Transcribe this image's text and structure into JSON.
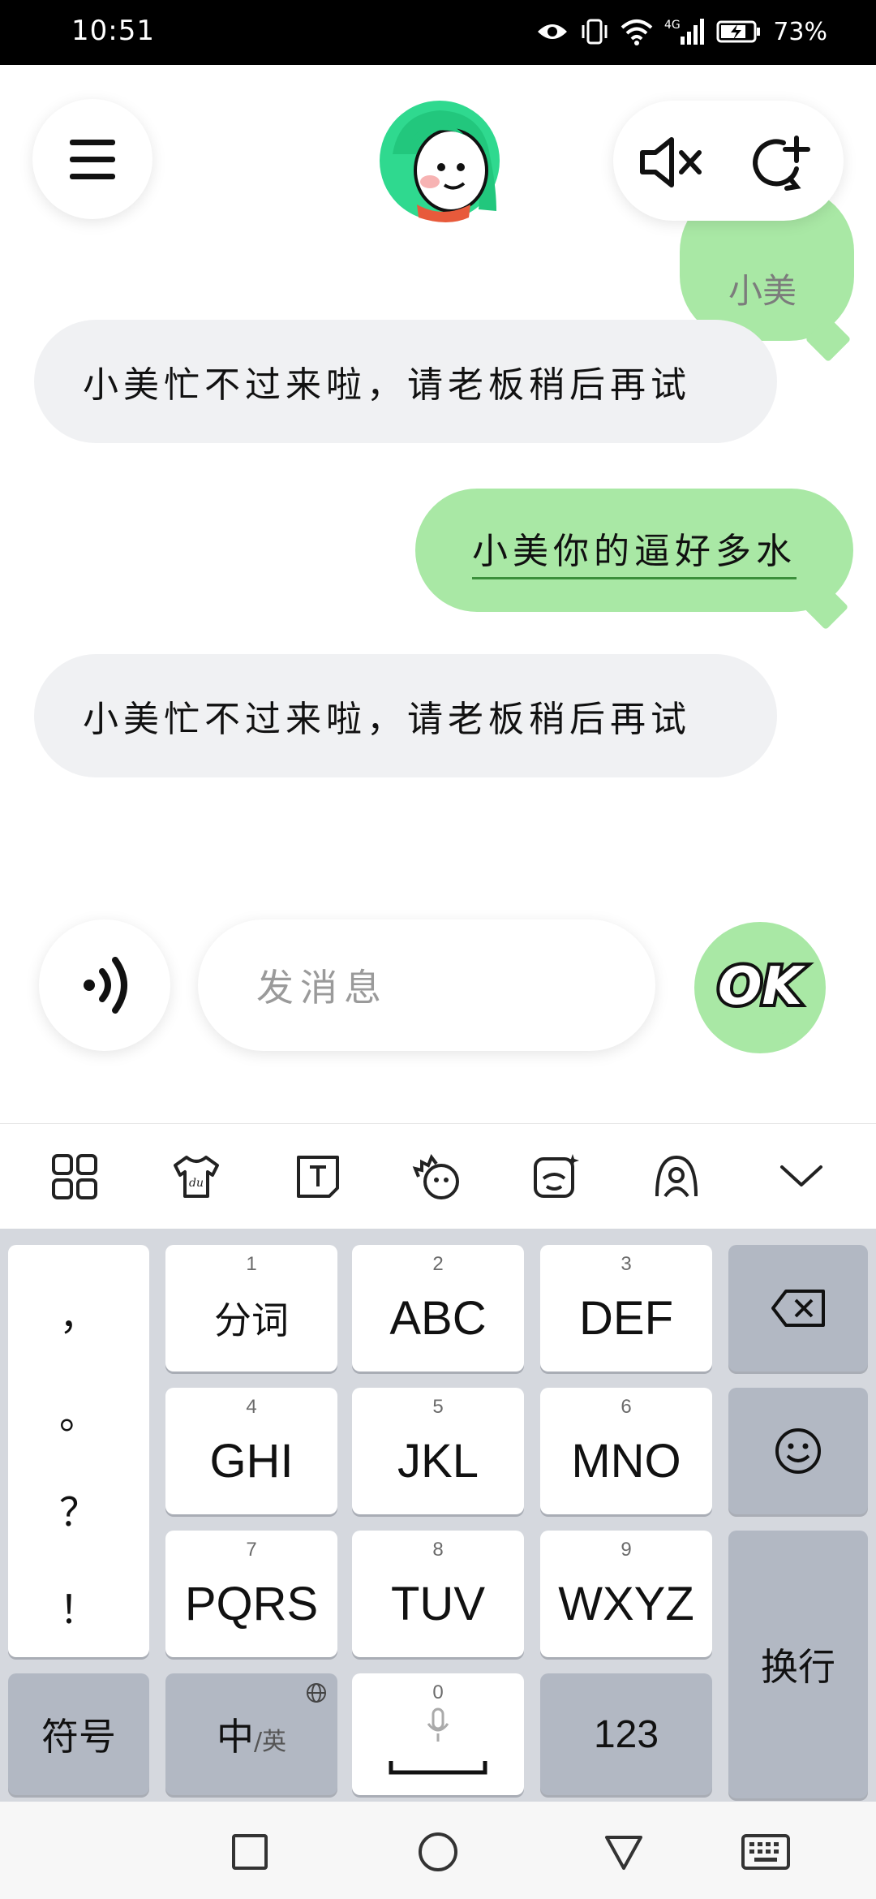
{
  "status_bar": {
    "time": "10:51",
    "battery_percent": "73%",
    "network": "4G",
    "icons": [
      "eye-icon",
      "vibrate-icon",
      "wifi-icon",
      "signal-icon",
      "battery-icon"
    ]
  },
  "header": {
    "menu_icon": "menu-icon",
    "avatar_icon": "character-avatar",
    "mute_icon": "speaker-mute-icon",
    "new_chat_icon": "refresh-plus-icon"
  },
  "messages": [
    {
      "side": "right",
      "text": "小美",
      "partial": true
    },
    {
      "side": "left",
      "text": "小美忙不过来啦，请老板稍后再试"
    },
    {
      "side": "right",
      "text": "小美你的逼好多水"
    },
    {
      "side": "left",
      "text": "小美忙不过来啦，请老板稍后再试"
    }
  ],
  "composer": {
    "placeholder": "发消息",
    "send_label": "OK",
    "voice_icon": "voice-wave-icon"
  },
  "keyboard_toolbar": {
    "icons": [
      "grid-icon",
      "skin-icon",
      "text-icon",
      "sticker-icon",
      "emoji-face-icon",
      "avatar-icon",
      "collapse-chevron-icon"
    ]
  },
  "keyboard": {
    "punctuation": [
      "，",
      "。",
      "？",
      "！"
    ],
    "keys": [
      {
        "num": "1",
        "label": "分词"
      },
      {
        "num": "2",
        "label": "ABC"
      },
      {
        "num": "3",
        "label": "DEF"
      },
      {
        "num": "4",
        "label": "GHI"
      },
      {
        "num": "5",
        "label": "JKL"
      },
      {
        "num": "6",
        "label": "MNO"
      },
      {
        "num": "7",
        "label": "PQRS"
      },
      {
        "num": "8",
        "label": "TUV"
      },
      {
        "num": "9",
        "label": "WXYZ"
      }
    ],
    "symbols": "符号",
    "lang_main": "中",
    "lang_alt": "/英",
    "space_num": "0",
    "numbers": "123",
    "enter": "换行",
    "backspace_icon": "backspace-icon",
    "emoji_icon": "smiley-icon"
  },
  "nav_bar": {
    "icons": [
      "square-recents-icon",
      "circle-home-icon",
      "triangle-back-icon",
      "keyboard-icon"
    ]
  },
  "colors": {
    "bubble_green": "#a9e8a5",
    "bubble_grey": "#f0f1f3",
    "keyboard_bg": "#d5d8de"
  }
}
